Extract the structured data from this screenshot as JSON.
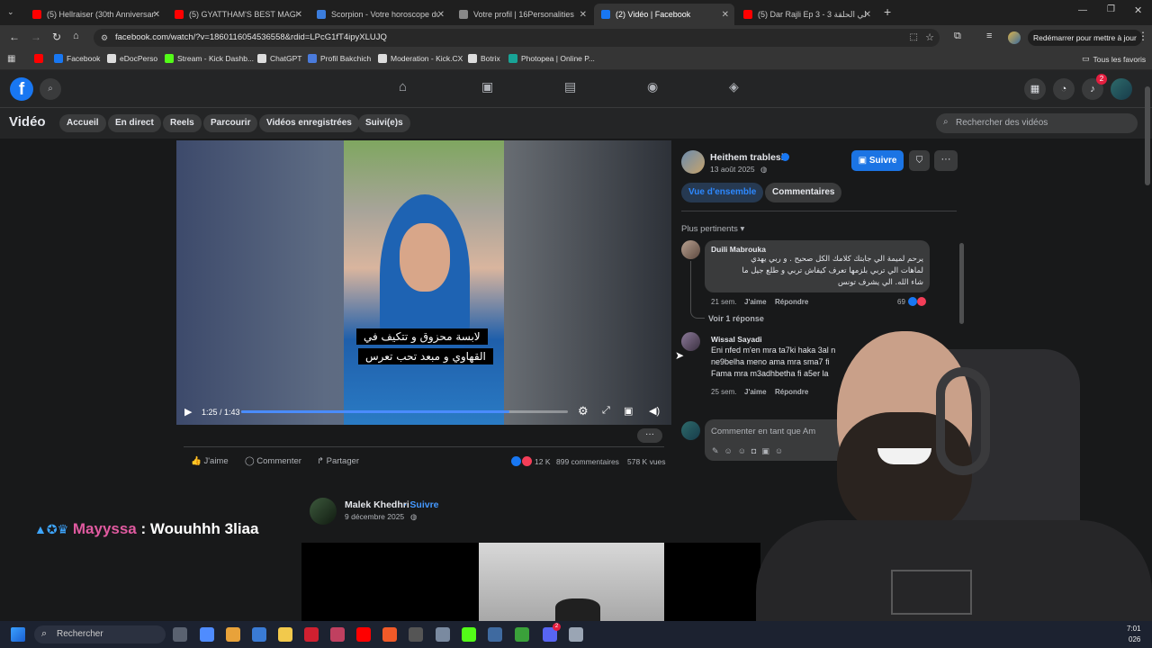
{
  "browser": {
    "tabs": [
      {
        "title": "(5) Hellraiser (30th Anniversary",
        "color": "#ff0000"
      },
      {
        "title": "(5) GYATTHAM'S BEST MAGIC R",
        "color": "#ff0000"
      },
      {
        "title": "Scorpion - Votre horoscope du",
        "color": "#3b7ddd"
      },
      {
        "title": "Votre profil | 16Personalities",
        "color": "#888888"
      },
      {
        "title": "(2) Vidéo | Facebook",
        "color": "#1877f2"
      },
      {
        "title": "(5) Dar Rajli Ep 3 - 3 دار رجلي الحلقة",
        "color": "#ff0000"
      }
    ],
    "url": "facebook.com/watch/?v=1860116054536558&rdid=LPcG1fT4ipyXLUJQ",
    "restart_label": "Redémarrer pour mettre à jour",
    "bookmarks": [
      {
        "label": "",
        "color": "#ff0000"
      },
      {
        "label": "Facebook",
        "color": "#1877f2"
      },
      {
        "label": "eDocPerso",
        "color": "#dddddd"
      },
      {
        "label": "Stream - Kick Dashb...",
        "color": "#53fc18"
      },
      {
        "label": "ChatGPT",
        "color": "#dddddd"
      },
      {
        "label": "Profil Bakchich",
        "color": "#4a7bdc"
      },
      {
        "label": "Moderation - Kick.CX",
        "color": "#dddddd"
      },
      {
        "label": "Botrix",
        "color": "#dddddd"
      },
      {
        "label": "Photopea | Online P...",
        "color": "#18a497"
      }
    ],
    "all_bookmarks": "Tous les favoris"
  },
  "fb": {
    "notif_count": "2",
    "section_title": "Vidéo",
    "nav": [
      "Accueil",
      "En direct",
      "Reels",
      "Parcourir",
      "Vidéos enregistrées",
      "Suivi(e)s"
    ],
    "search_placeholder": "Rechercher des vidéos"
  },
  "video": {
    "subtitle_line1": "لابسة محزوق و تتكيف في",
    "subtitle_line2": "القهاوي و مبعد تحب تعرس",
    "time": "1:25 / 1:43",
    "progress": 0.82,
    "actions": {
      "like": "J'aime",
      "comment": "Commenter",
      "share": "Partager"
    },
    "stats": {
      "reactions": "12 K",
      "comments": "899 commentaires",
      "views": "578 K vues"
    }
  },
  "post": {
    "author": "Heithem trablesi",
    "date": "13 août 2025",
    "follow": "Suivre",
    "tab_overview": "Vue d'ensemble",
    "tab_comments": "Commentaires",
    "sort": "Plus pertinents",
    "comments": [
      {
        "author": "Duili Mabrouka",
        "lines": [
          "يرحم لميمة الي جابتك كلامك الكل صحيح . و ربي يهدي",
          "لماهات الي تربي بلزمها تعرف كيفاش تربي و طلع جيل ما",
          "شاء الله. الي يشرف تونس"
        ],
        "age": "21 sem.",
        "like": "J'aime",
        "reply": "Répondre",
        "reactions": "69",
        "see_replies": "Voir 1 réponse"
      },
      {
        "author": "Wissal Sayadi",
        "lines": [
          "Eni nfed m'en mra ta7ki haka 3al n",
          "ne9belha meno ama mra sma7 fi",
          "Fama mra m3adhbetha fi a5er la"
        ],
        "age": "25 sem.",
        "like": "J'aime",
        "reply": "Répondre"
      }
    ],
    "comment_placeholder": "Commenter en tant que Am"
  },
  "next_post": {
    "author": "Malek Khedhri",
    "follow": "Suivre",
    "date": "9 décembre 2025"
  },
  "chat": {
    "user": "Mayyssa",
    "message": ": Wouuhhh 3liaa",
    "user_color": "#e05aa0"
  },
  "taskbar": {
    "search": "Rechercher",
    "time": "7:01",
    "date_partial": "026",
    "badge": "2"
  }
}
